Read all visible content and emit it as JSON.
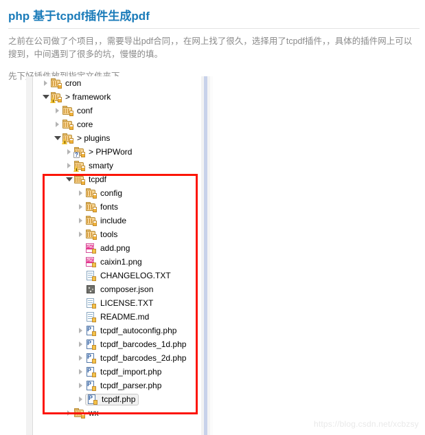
{
  "article": {
    "title": "php 基于tcpdf插件生成pdf",
    "paragraph1": "之前在公司做了个项目，，需要导出pdf合同，，在网上找了很久，选择用了tcpdf插件，，具体的插件网上可以搜到，中间遇到了很多的坑，慢慢的填。",
    "paragraph2": "先下好插件放到指定文件夹下"
  },
  "colors": {
    "title": "#1a7bb9",
    "body_text": "#8a8a8a",
    "annotation_box": "#fc1505",
    "watermark": "#e9e9e9",
    "selection_bg": "#f1f1f1",
    "scrollbar_thumb": "#c8d2ea"
  },
  "file_tree": {
    "rows": [
      {
        "label": "cron",
        "depth": 0,
        "twisty": "collapsed",
        "icon": "folder-icon",
        "badge": "none",
        "prefix": "",
        "selected": false
      },
      {
        "label": "framework",
        "depth": 0,
        "twisty": "expanded",
        "icon": "folder-icon",
        "badge": "warning",
        "prefix": "> ",
        "selected": false
      },
      {
        "label": "conf",
        "depth": 1,
        "twisty": "collapsed",
        "icon": "folder-icon",
        "badge": "none",
        "prefix": "",
        "selected": false
      },
      {
        "label": "core",
        "depth": 1,
        "twisty": "collapsed",
        "icon": "folder-icon",
        "badge": "none",
        "prefix": "",
        "selected": false
      },
      {
        "label": "plugins",
        "depth": 1,
        "twisty": "expanded",
        "icon": "folder-icon",
        "badge": "warning",
        "prefix": "> ",
        "selected": false
      },
      {
        "label": "PHPWord",
        "depth": 2,
        "twisty": "collapsed",
        "icon": "folder-icon",
        "badge": "question",
        "prefix": "> ",
        "selected": false
      },
      {
        "label": "smarty",
        "depth": 2,
        "twisty": "collapsed",
        "icon": "folder-icon",
        "badge": "warning",
        "prefix": "",
        "selected": false
      },
      {
        "label": "tcpdf",
        "depth": 2,
        "twisty": "expanded",
        "icon": "folder-icon",
        "badge": "none",
        "prefix": "",
        "selected": false
      },
      {
        "label": "config",
        "depth": 3,
        "twisty": "collapsed",
        "icon": "folder-icon",
        "badge": "none",
        "prefix": "",
        "selected": false
      },
      {
        "label": "fonts",
        "depth": 3,
        "twisty": "collapsed",
        "icon": "folder-icon",
        "badge": "none",
        "prefix": "",
        "selected": false
      },
      {
        "label": "include",
        "depth": 3,
        "twisty": "collapsed",
        "icon": "folder-icon",
        "badge": "none",
        "prefix": "",
        "selected": false
      },
      {
        "label": "tools",
        "depth": 3,
        "twisty": "collapsed",
        "icon": "folder-icon",
        "badge": "none",
        "prefix": "",
        "selected": false
      },
      {
        "label": "add.png",
        "depth": 3,
        "twisty": "none",
        "icon": "png-file-icon",
        "badge": "none",
        "prefix": "",
        "selected": false
      },
      {
        "label": "caixin1.png",
        "depth": 3,
        "twisty": "none",
        "icon": "png-file-icon",
        "badge": "none",
        "prefix": "",
        "selected": false
      },
      {
        "label": "CHANGELOG.TXT",
        "depth": 3,
        "twisty": "none",
        "icon": "text-file-icon",
        "badge": "none",
        "prefix": "",
        "selected": false
      },
      {
        "label": "composer.json",
        "depth": 3,
        "twisty": "none",
        "icon": "json-file-icon",
        "badge": "none",
        "prefix": "",
        "selected": false
      },
      {
        "label": "LICENSE.TXT",
        "depth": 3,
        "twisty": "none",
        "icon": "text-file-icon",
        "badge": "none",
        "prefix": "",
        "selected": false
      },
      {
        "label": "README.md",
        "depth": 3,
        "twisty": "none",
        "icon": "text-file-icon",
        "badge": "none",
        "prefix": "",
        "selected": false
      },
      {
        "label": "tcpdf_autoconfig.php",
        "depth": 3,
        "twisty": "collapsed",
        "icon": "php-file-icon",
        "badge": "none",
        "prefix": "",
        "selected": false
      },
      {
        "label": "tcpdf_barcodes_1d.php",
        "depth": 3,
        "twisty": "collapsed",
        "icon": "php-file-icon",
        "badge": "none",
        "prefix": "",
        "selected": false
      },
      {
        "label": "tcpdf_barcodes_2d.php",
        "depth": 3,
        "twisty": "collapsed",
        "icon": "php-file-icon",
        "badge": "none",
        "prefix": "",
        "selected": false
      },
      {
        "label": "tcpdf_import.php",
        "depth": 3,
        "twisty": "collapsed",
        "icon": "php-file-icon",
        "badge": "none",
        "prefix": "",
        "selected": false
      },
      {
        "label": "tcpdf_parser.php",
        "depth": 3,
        "twisty": "collapsed",
        "icon": "php-file-icon",
        "badge": "none",
        "prefix": "",
        "selected": false
      },
      {
        "label": "tcpdf.php",
        "depth": 3,
        "twisty": "collapsed",
        "icon": "php-file-icon",
        "badge": "none",
        "prefix": "",
        "selected": true
      },
      {
        "label": "wx",
        "depth": 2,
        "twisty": "collapsed",
        "icon": "folder-icon",
        "badge": "none",
        "prefix": "",
        "selected": false
      }
    ]
  },
  "watermark": {
    "text": "https://blog.csdn.net/xcbzsy"
  }
}
